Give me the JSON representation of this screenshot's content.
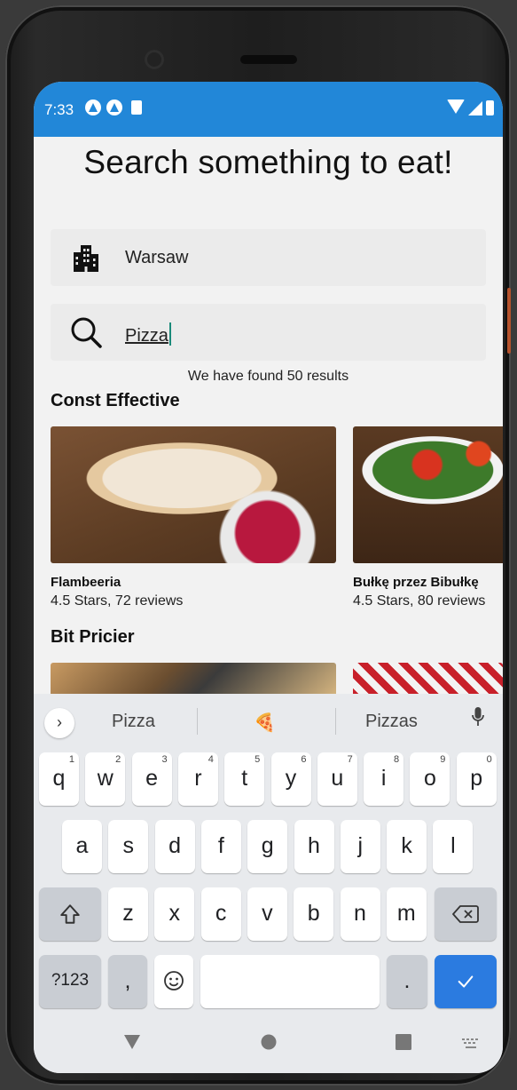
{
  "status_bar": {
    "time": "7:33"
  },
  "app": {
    "title": "Search something to eat!",
    "city_field": {
      "value": "Warsaw"
    },
    "search_field": {
      "value": "Pizza"
    },
    "result_count": "We have found 50 results",
    "sections": [
      {
        "title": "Const Effective",
        "cards": [
          {
            "name": "Flambeeria",
            "rating": "4.5 Stars, 72 reviews"
          },
          {
            "name": "Bułkę przez Bibułkę",
            "rating": "4.5 Stars, 80 reviews"
          }
        ]
      },
      {
        "title": "Bit Pricier"
      }
    ]
  },
  "keyboard": {
    "suggestions": [
      "Pizza",
      "🍕",
      "Pizzas"
    ],
    "row1": [
      "q",
      "w",
      "e",
      "r",
      "t",
      "y",
      "u",
      "i",
      "o",
      "p"
    ],
    "row1_hints": [
      "1",
      "2",
      "3",
      "4",
      "5",
      "6",
      "7",
      "8",
      "9",
      "0"
    ],
    "row2": [
      "a",
      "s",
      "d",
      "f",
      "g",
      "h",
      "j",
      "k",
      "l"
    ],
    "row3": [
      "z",
      "x",
      "c",
      "v",
      "b",
      "n",
      "m"
    ],
    "symbols_key": "?123",
    "comma_key": ",",
    "period_key": "."
  }
}
